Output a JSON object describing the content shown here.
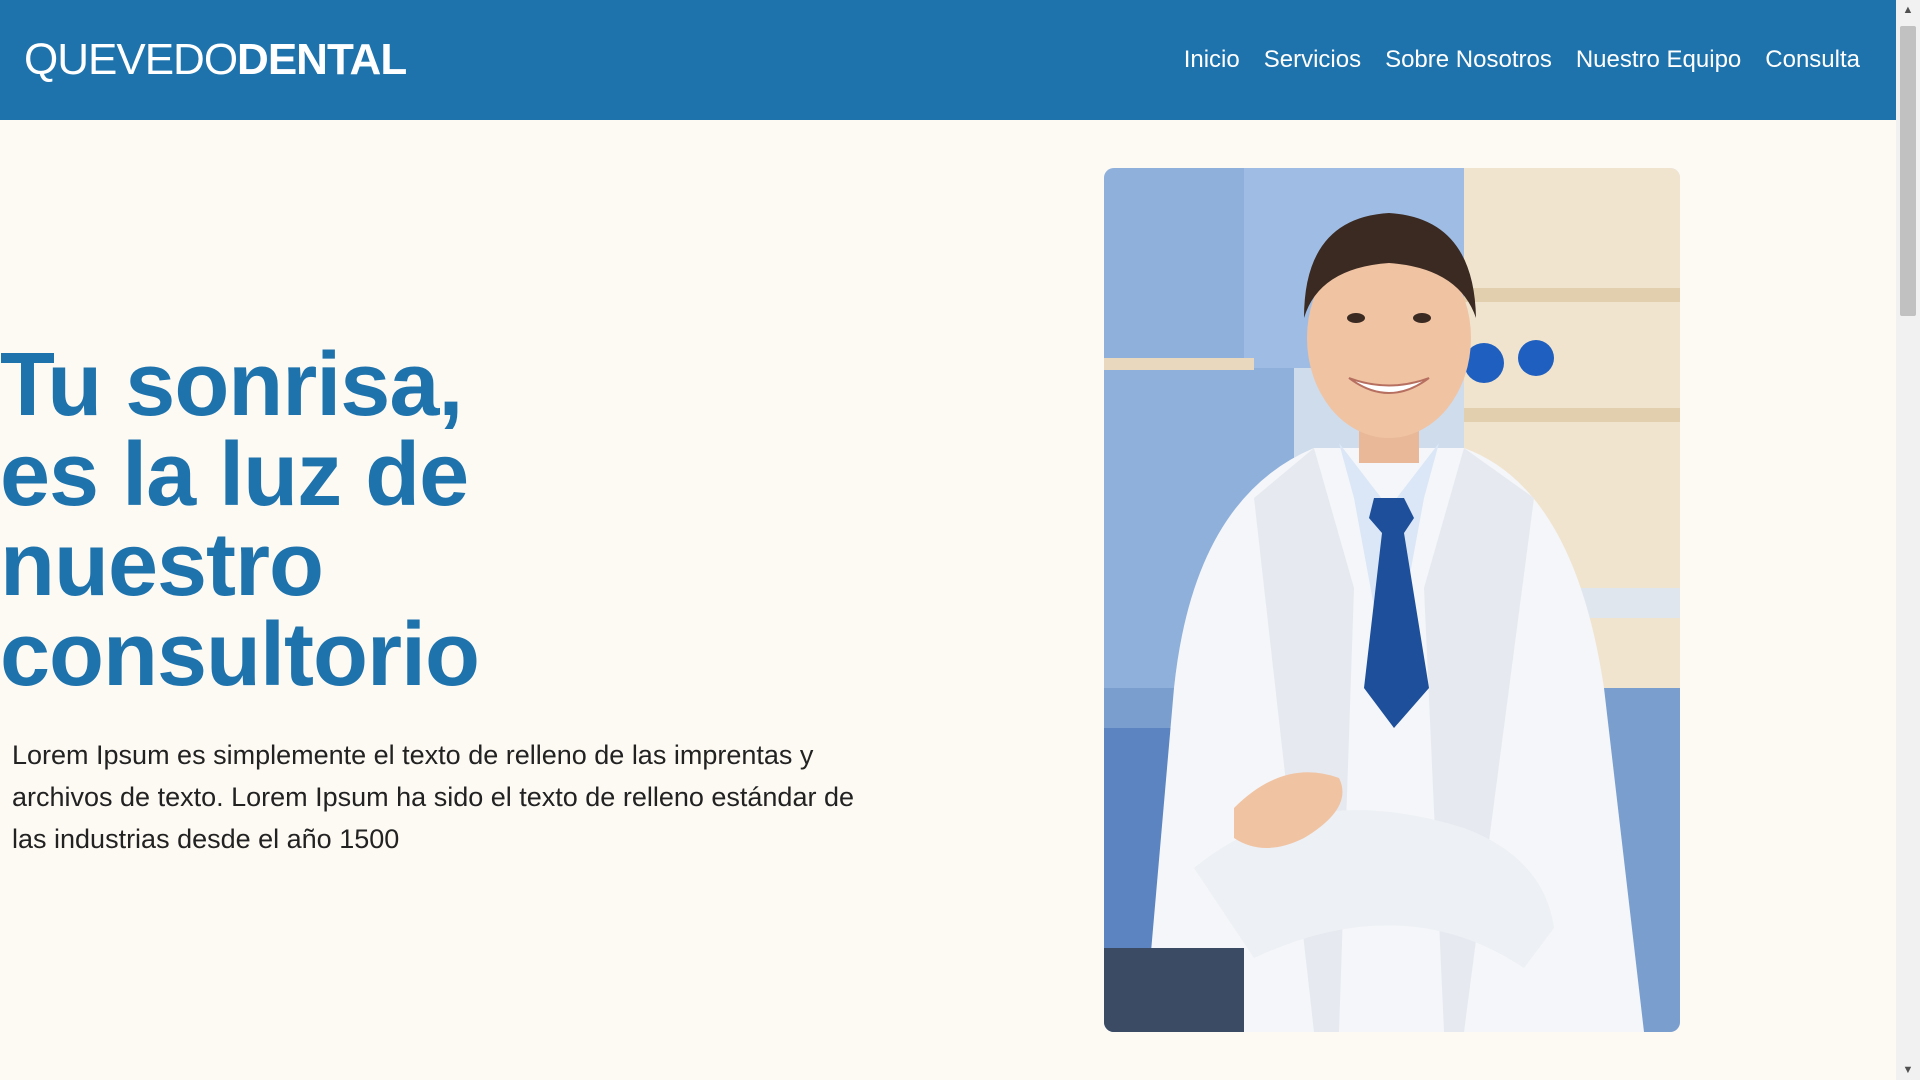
{
  "header": {
    "brand_light": "QUEVEDO",
    "brand_bold": "DENTAL",
    "background": "#1e73ad"
  },
  "nav": {
    "items": [
      {
        "label": "Inicio"
      },
      {
        "label": "Servicios"
      },
      {
        "label": "Sobre Nosotros"
      },
      {
        "label": "Nuestro Equipo"
      },
      {
        "label": "Consulta"
      }
    ]
  },
  "hero": {
    "title_lines": [
      "Tu sonrisa,",
      "es la luz de",
      "nuestro",
      "consultorio"
    ],
    "description": "Lorem Ipsum es simplemente el texto de relleno de las imprentas y archivos de texto. Lorem Ipsum ha sido el texto de relleno estándar de las industrias desde el año 1500",
    "title_color": "#1e73ad"
  },
  "colors": {
    "accent": "#1e73ad",
    "page_background": "#fdf9f3",
    "text": "#222222"
  },
  "icons": {
    "scroll_up": "triangle-up-icon",
    "scroll_down": "triangle-down-icon"
  }
}
